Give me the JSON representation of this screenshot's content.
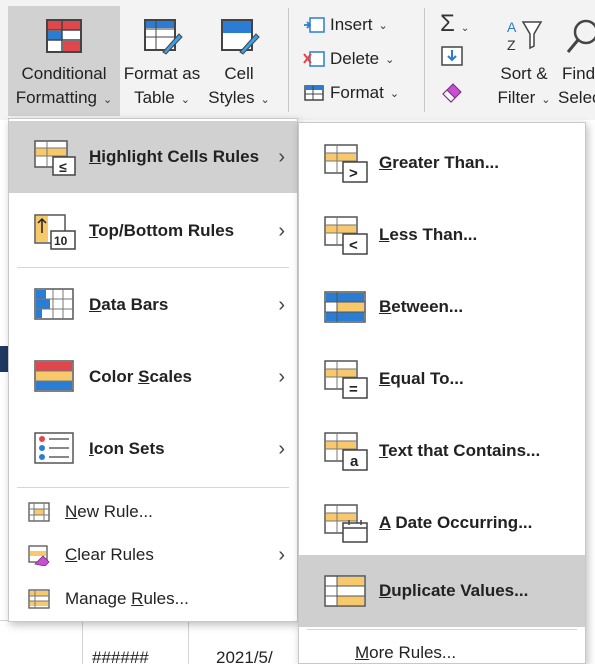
{
  "ribbon": {
    "conditional_formatting": {
      "line1": "Conditional",
      "line2": "Formatting"
    },
    "format_as_table": {
      "line1": "Format as",
      "line2": "Table"
    },
    "cell_styles": {
      "line1": "Cell",
      "line2": "Styles"
    },
    "cells": {
      "insert": "Insert",
      "delete": "Delete",
      "format": "Format"
    },
    "sort_filter": {
      "line1": "Sort &",
      "line2": "Filter"
    },
    "find_select": {
      "line1": "Find",
      "line2": "Selec"
    }
  },
  "main_menu": {
    "items": [
      {
        "label": "Highlight Cells Rules",
        "mnemonic": "H",
        "rest": "ighlight Cells Rules",
        "icon": "highlight-cells-icon",
        "has_submenu": true,
        "highlighted": true
      },
      {
        "label": "Top/Bottom Rules",
        "mnemonic": "T",
        "rest": "op/Bottom Rules",
        "icon": "top-bottom-icon",
        "has_submenu": true
      },
      {
        "label": "Data Bars",
        "mnemonic": "D",
        "rest": "ata Bars",
        "icon": "data-bars-icon",
        "has_submenu": true
      },
      {
        "label": "Color Scales",
        "pre": "Color ",
        "mnemonic": "S",
        "rest": "cales",
        "icon": "color-scales-icon",
        "has_submenu": true
      },
      {
        "label": "Icon Sets",
        "mnemonic": "I",
        "rest": "con Sets",
        "icon": "icon-sets-icon",
        "has_submenu": true
      }
    ],
    "actions": [
      {
        "label": "New Rule...",
        "mnemonic": "N",
        "rest": "ew Rule...",
        "icon": "new-rule-icon"
      },
      {
        "label": "Clear Rules",
        "mnemonic": "C",
        "rest": "lear Rules",
        "icon": "clear-rules-icon",
        "has_submenu": true
      },
      {
        "label": "Manage Rules...",
        "pre": "Manage ",
        "mnemonic": "R",
        "rest": "ules...",
        "icon": "manage-rules-icon"
      }
    ]
  },
  "sub_menu": {
    "items": [
      {
        "label": "Greater Than...",
        "mnemonic": "G",
        "rest": "reater Than...",
        "symbol": ">",
        "icon": "greater-than-icon"
      },
      {
        "label": "Less Than...",
        "mnemonic": "L",
        "rest": "ess Than...",
        "symbol": "<",
        "icon": "less-than-icon"
      },
      {
        "label": "Between...",
        "mnemonic": "B",
        "rest": "etween...",
        "symbol": "",
        "icon": "between-icon"
      },
      {
        "label": "Equal To...",
        "mnemonic": "E",
        "rest": "qual To...",
        "symbol": "=",
        "icon": "equal-to-icon"
      },
      {
        "label": "Text that Contains...",
        "mnemonic": "T",
        "rest": "ext that Contains...",
        "symbol": "a",
        "icon": "text-contains-icon"
      },
      {
        "label": "A Date Occurring...",
        "mnemonic": "A",
        "rest": " Date Occurring...",
        "symbol": "",
        "icon": "date-occurring-icon"
      },
      {
        "label": "Duplicate Values...",
        "mnemonic": "D",
        "rest": "uplicate Values...",
        "symbol": "",
        "icon": "duplicate-values-icon",
        "highlighted": true
      }
    ],
    "more": {
      "label": "More Rules...",
      "mnemonic": "M",
      "rest": "ore Rules..."
    }
  },
  "sheet": {
    "cell_a": "######",
    "cell_b": "2021/5/"
  },
  "colors": {
    "accent_blue": "#2b7cd3",
    "rule_red": "#e0474c",
    "rule_yellow": "#f7c96b",
    "menu_highlight": "#d1d1d1"
  }
}
